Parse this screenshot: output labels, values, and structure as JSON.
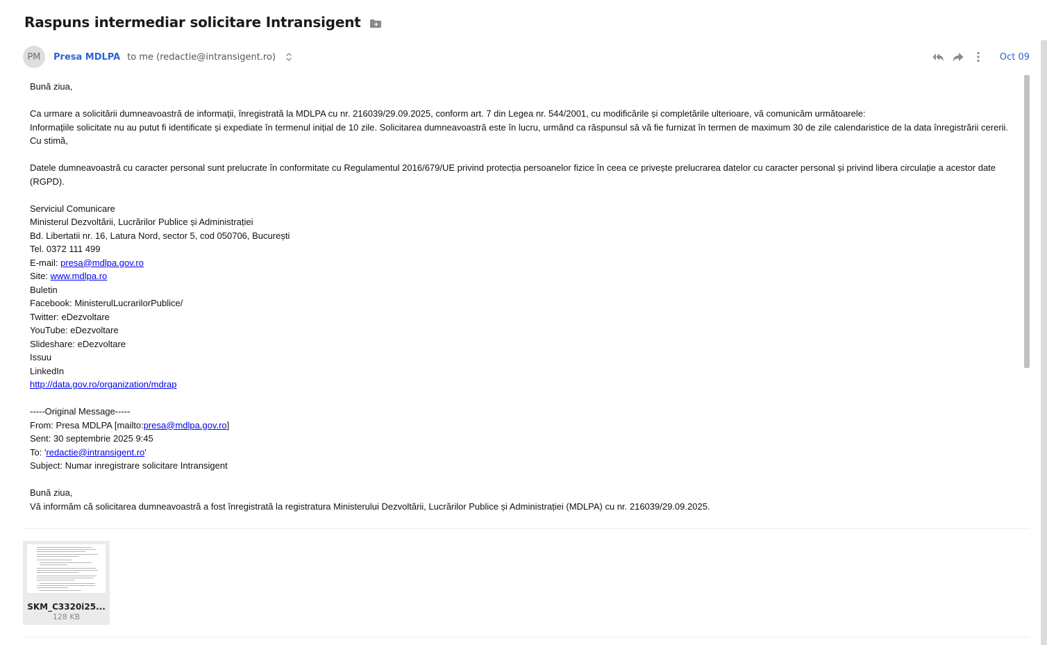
{
  "email": {
    "subject": "Raspuns intermediar solicitare Intransigent",
    "sender": {
      "initials": "PM",
      "name": "Presa MDLPA",
      "recipient": "to me (redactie@intransigent.ro)"
    },
    "date": "Oct 09",
    "icons": {
      "folder": "folder-move-icon",
      "expand": "expand-updown-icon",
      "reply_all": "reply-all-icon",
      "forward": "forward-icon",
      "more": "more-vert-icon"
    },
    "body": {
      "greeting": "Bună ziua,",
      "intro": "Ca urmare a solicitării dumneavoastră de informații, înregistrată la MDLPA cu nr. 216039/29.09.2025, conform art. 7 din Legea nr. 544/2001, cu modificările și completările ulterioare, vă comunicăm următoarele:",
      "info": "Informațiile solicitate nu au putut fi identificate și expediate în termenul inițial de 10 zile. Solicitarea dumneavoastră este în lucru, urmând ca răspunsul să vă fie furnizat în termen de maximum 30 de zile calendaristice de la data înregistrării cererii.",
      "signoff": "Cu stimă,",
      "gdpr": "Datele dumneavoastră cu caracter personal sunt prelucrate în conformitate cu Regulamentul 2016/679/UE privind protecția persoanelor fizice în ceea ce privește prelucrarea datelor cu caracter personal și privind libera circulație a acestor date (RGPD).",
      "signature": {
        "dept": "Serviciul Comunicare",
        "ministry": "Ministerul Dezvoltării, Lucrărilor Publice și Administrației",
        "address": "Bd. Libertatii nr. 16, Latura Nord, sector 5, cod 050706, București",
        "tel": "Tel. 0372 111 499",
        "email_label": "E-mail: ",
        "email_link": "presa@mdlpa.gov.ro",
        "site_label": "Site: ",
        "site_link": "www.mdlpa.ro",
        "buletin": "Buletin",
        "facebook": "Facebook: MinisterulLucrarilorPublice/",
        "twitter": "Twitter: eDezvoltare",
        "youtube": "YouTube: eDezvoltare",
        "slideshare": "Slideshare: eDezvoltare",
        "issuu": "Issuu",
        "linkedin": "LinkedIn",
        "data_link": "http://data.gov.ro/organization/mdrap"
      },
      "original": {
        "header": "-----Original Message-----",
        "from_label": "From: Presa MDLPA [mailto:",
        "from_link": "presa@mdlpa.gov.ro",
        "from_end": "]",
        "sent": "Sent: 30 septembrie 2025 9:45",
        "to_label": "To: '",
        "to_link": "redactie@intransigent.ro",
        "to_end": "'",
        "subject": "Subject: Numar inregistrare solicitare Intransigent",
        "greeting": "Bună ziua,",
        "text": "Vă informăm că solicitarea dumneavoastră a fost înregistrată la registratura Ministerului Dezvoltării, Lucrărilor Publice și Administrației (MDLPA) cu nr. 216039/29.09.2025."
      }
    },
    "attachment": {
      "name": "SKM_C3320i25...",
      "size": "128 KB"
    }
  }
}
